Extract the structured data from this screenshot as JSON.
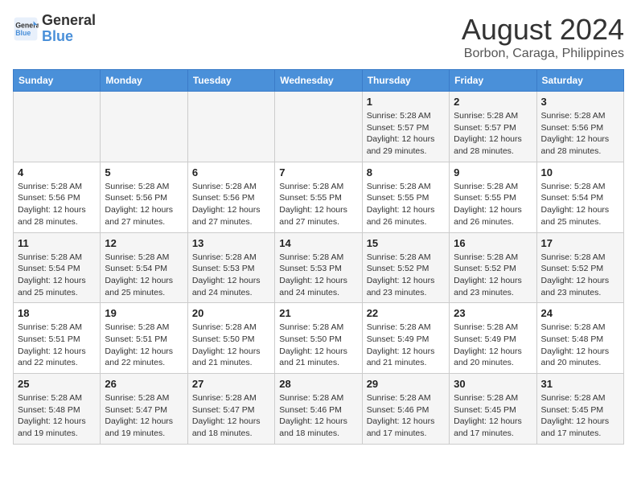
{
  "header": {
    "logo_line1": "General",
    "logo_line2": "Blue",
    "month_year": "August 2024",
    "location": "Borbon, Caraga, Philippines"
  },
  "days_of_week": [
    "Sunday",
    "Monday",
    "Tuesday",
    "Wednesday",
    "Thursday",
    "Friday",
    "Saturday"
  ],
  "weeks": [
    [
      {
        "day": "",
        "info": ""
      },
      {
        "day": "",
        "info": ""
      },
      {
        "day": "",
        "info": ""
      },
      {
        "day": "",
        "info": ""
      },
      {
        "day": "1",
        "info": "Sunrise: 5:28 AM\nSunset: 5:57 PM\nDaylight: 12 hours\nand 29 minutes."
      },
      {
        "day": "2",
        "info": "Sunrise: 5:28 AM\nSunset: 5:57 PM\nDaylight: 12 hours\nand 28 minutes."
      },
      {
        "day": "3",
        "info": "Sunrise: 5:28 AM\nSunset: 5:56 PM\nDaylight: 12 hours\nand 28 minutes."
      }
    ],
    [
      {
        "day": "4",
        "info": "Sunrise: 5:28 AM\nSunset: 5:56 PM\nDaylight: 12 hours\nand 28 minutes."
      },
      {
        "day": "5",
        "info": "Sunrise: 5:28 AM\nSunset: 5:56 PM\nDaylight: 12 hours\nand 27 minutes."
      },
      {
        "day": "6",
        "info": "Sunrise: 5:28 AM\nSunset: 5:56 PM\nDaylight: 12 hours\nand 27 minutes."
      },
      {
        "day": "7",
        "info": "Sunrise: 5:28 AM\nSunset: 5:55 PM\nDaylight: 12 hours\nand 27 minutes."
      },
      {
        "day": "8",
        "info": "Sunrise: 5:28 AM\nSunset: 5:55 PM\nDaylight: 12 hours\nand 26 minutes."
      },
      {
        "day": "9",
        "info": "Sunrise: 5:28 AM\nSunset: 5:55 PM\nDaylight: 12 hours\nand 26 minutes."
      },
      {
        "day": "10",
        "info": "Sunrise: 5:28 AM\nSunset: 5:54 PM\nDaylight: 12 hours\nand 25 minutes."
      }
    ],
    [
      {
        "day": "11",
        "info": "Sunrise: 5:28 AM\nSunset: 5:54 PM\nDaylight: 12 hours\nand 25 minutes."
      },
      {
        "day": "12",
        "info": "Sunrise: 5:28 AM\nSunset: 5:54 PM\nDaylight: 12 hours\nand 25 minutes."
      },
      {
        "day": "13",
        "info": "Sunrise: 5:28 AM\nSunset: 5:53 PM\nDaylight: 12 hours\nand 24 minutes."
      },
      {
        "day": "14",
        "info": "Sunrise: 5:28 AM\nSunset: 5:53 PM\nDaylight: 12 hours\nand 24 minutes."
      },
      {
        "day": "15",
        "info": "Sunrise: 5:28 AM\nSunset: 5:52 PM\nDaylight: 12 hours\nand 23 minutes."
      },
      {
        "day": "16",
        "info": "Sunrise: 5:28 AM\nSunset: 5:52 PM\nDaylight: 12 hours\nand 23 minutes."
      },
      {
        "day": "17",
        "info": "Sunrise: 5:28 AM\nSunset: 5:52 PM\nDaylight: 12 hours\nand 23 minutes."
      }
    ],
    [
      {
        "day": "18",
        "info": "Sunrise: 5:28 AM\nSunset: 5:51 PM\nDaylight: 12 hours\nand 22 minutes."
      },
      {
        "day": "19",
        "info": "Sunrise: 5:28 AM\nSunset: 5:51 PM\nDaylight: 12 hours\nand 22 minutes."
      },
      {
        "day": "20",
        "info": "Sunrise: 5:28 AM\nSunset: 5:50 PM\nDaylight: 12 hours\nand 21 minutes."
      },
      {
        "day": "21",
        "info": "Sunrise: 5:28 AM\nSunset: 5:50 PM\nDaylight: 12 hours\nand 21 minutes."
      },
      {
        "day": "22",
        "info": "Sunrise: 5:28 AM\nSunset: 5:49 PM\nDaylight: 12 hours\nand 21 minutes."
      },
      {
        "day": "23",
        "info": "Sunrise: 5:28 AM\nSunset: 5:49 PM\nDaylight: 12 hours\nand 20 minutes."
      },
      {
        "day": "24",
        "info": "Sunrise: 5:28 AM\nSunset: 5:48 PM\nDaylight: 12 hours\nand 20 minutes."
      }
    ],
    [
      {
        "day": "25",
        "info": "Sunrise: 5:28 AM\nSunset: 5:48 PM\nDaylight: 12 hours\nand 19 minutes."
      },
      {
        "day": "26",
        "info": "Sunrise: 5:28 AM\nSunset: 5:47 PM\nDaylight: 12 hours\nand 19 minutes."
      },
      {
        "day": "27",
        "info": "Sunrise: 5:28 AM\nSunset: 5:47 PM\nDaylight: 12 hours\nand 18 minutes."
      },
      {
        "day": "28",
        "info": "Sunrise: 5:28 AM\nSunset: 5:46 PM\nDaylight: 12 hours\nand 18 minutes."
      },
      {
        "day": "29",
        "info": "Sunrise: 5:28 AM\nSunset: 5:46 PM\nDaylight: 12 hours\nand 17 minutes."
      },
      {
        "day": "30",
        "info": "Sunrise: 5:28 AM\nSunset: 5:45 PM\nDaylight: 12 hours\nand 17 minutes."
      },
      {
        "day": "31",
        "info": "Sunrise: 5:28 AM\nSunset: 5:45 PM\nDaylight: 12 hours\nand 17 minutes."
      }
    ]
  ]
}
